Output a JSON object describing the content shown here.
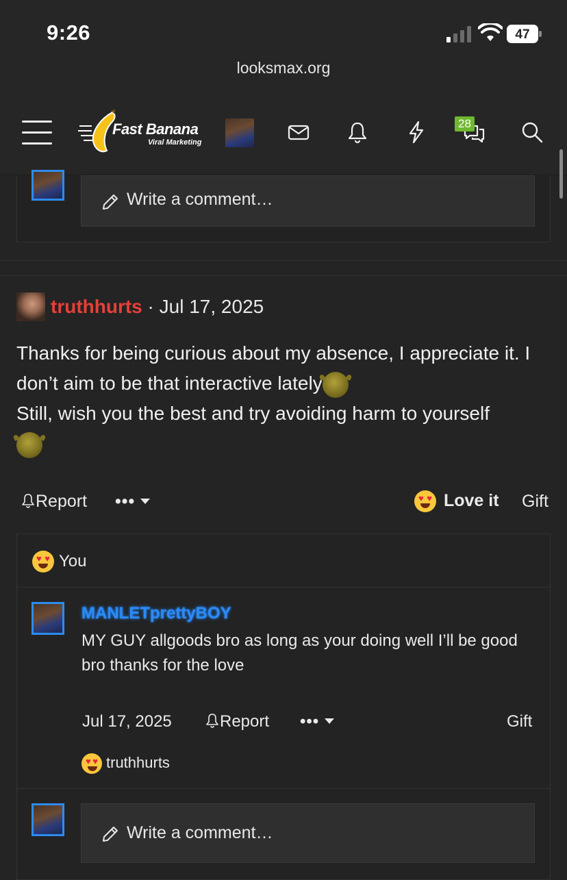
{
  "status_bar": {
    "time": "9:26",
    "battery": "47",
    "url": "looksmax.org"
  },
  "nav": {
    "logo_title": "Fast Banana",
    "logo_subtitle": "Viral Marketing",
    "chat_badge": "28",
    "icons": [
      "menu-icon",
      "mail-icon",
      "bell-icon",
      "lightning-icon",
      "chat-icon",
      "search-icon"
    ],
    "accent": "#6fb82f"
  },
  "top_comment": {
    "placeholder": "Write a comment…"
  },
  "post": {
    "username": "truthhurts",
    "separator": "·",
    "date": "Jul 17, 2025",
    "line1": "Thanks for being curious about my absence, I appreciate it. I don’t aim to be that interactive lately",
    "line2": "Still, wish you the best and try avoiding harm to yourself",
    "username_color": "#e5403a",
    "actions": {
      "report": "Report",
      "more": "•••",
      "love": "Love it",
      "gift": "Gift"
    },
    "reactions": {
      "who": "You"
    }
  },
  "reply": {
    "username": "MANLETprettyBOY",
    "text": "MY GUY allgoods bro as long as your doing well I’ll be good bro thanks for the love",
    "date": "Jul 17, 2025",
    "report": "Report",
    "more": "•••",
    "gift": "Gift",
    "reaction_user": "truthhurts",
    "username_color": "#2b8bf7"
  },
  "bottom_comment": {
    "placeholder": "Write a comment…"
  }
}
